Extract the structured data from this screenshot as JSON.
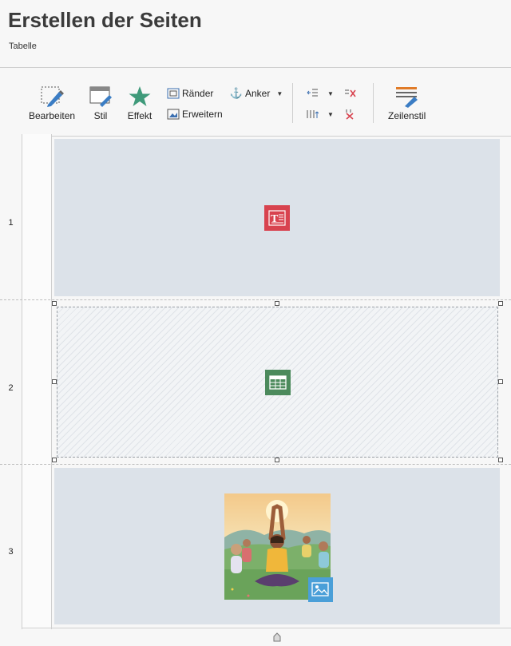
{
  "page": {
    "title": "Erstellen der Seiten",
    "subtitle": "Tabelle"
  },
  "toolbar": {
    "edit_label": "Bearbeiten",
    "style_label": "Stil",
    "effect_label": "Effekt",
    "margins_label": "Ränder",
    "expand_label": "Erweitern",
    "anchor_label": "Anker",
    "row_style_label": "Zeilenstil"
  },
  "rows": [
    {
      "number": "1",
      "content": "text-frame-icon"
    },
    {
      "number": "2",
      "content": "table-frame-icon"
    },
    {
      "number": "3",
      "content": "yoga-image"
    }
  ],
  "colors": {
    "cell_bg": "#dce2e9",
    "text_badge": "#d8434f",
    "table_badge": "#4c8a5c",
    "image_badge": "#4a9fd8",
    "effect_star": "#3f9a7a"
  }
}
